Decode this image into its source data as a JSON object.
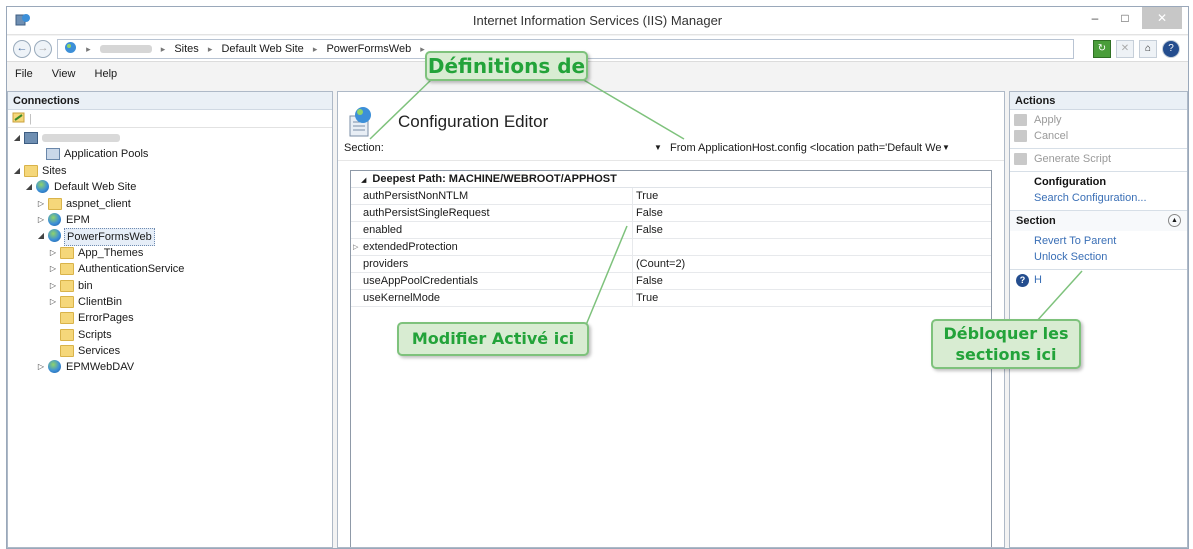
{
  "window": {
    "title": "Internet Information Services (IIS) Manager",
    "controls": {
      "minimize": "–",
      "maximize": "□",
      "close": "✕"
    }
  },
  "address": {
    "crumbs": [
      "Sites",
      "Default Web Site",
      "PowerFormsWeb"
    ],
    "separator": "▸"
  },
  "menu": [
    "File",
    "View",
    "Help"
  ],
  "connections": {
    "title": "Connections",
    "tree": [
      {
        "label": "",
        "blurred": true,
        "icon": "server-icon",
        "expander": "◢"
      },
      {
        "label": "Application Pools",
        "icon": "app-pool-icon",
        "expander": ""
      },
      {
        "label": "Sites",
        "icon": "sites-folder-icon",
        "expander": "◢"
      },
      {
        "label": "Default Web Site",
        "icon": "globe-icon",
        "expander": "◢"
      },
      {
        "label": "aspnet_client",
        "icon": "folder-icon",
        "expander": "▷"
      },
      {
        "label": "EPM",
        "icon": "web-app-icon",
        "expander": "▷"
      },
      {
        "label": "PowerFormsWeb",
        "icon": "web-app-icon",
        "expander": "◢",
        "selected": true
      },
      {
        "label": "App_Themes",
        "icon": "folder-icon",
        "expander": "▷"
      },
      {
        "label": "AuthenticationService",
        "icon": "folder-icon",
        "expander": "▷"
      },
      {
        "label": "bin",
        "icon": "folder-icon",
        "expander": "▷"
      },
      {
        "label": "ClientBin",
        "icon": "folder-icon",
        "expander": "▷"
      },
      {
        "label": "ErrorPages",
        "icon": "folder-icon",
        "expander": ""
      },
      {
        "label": "Scripts",
        "icon": "folder-icon",
        "expander": ""
      },
      {
        "label": "Services",
        "icon": "folder-icon",
        "expander": ""
      },
      {
        "label": "EPMWebDAV",
        "icon": "globe-icon",
        "expander": "▷"
      }
    ]
  },
  "editor": {
    "title": "Configuration Editor",
    "section_label": "Section:",
    "from_label": "From:",
    "from_value": "ApplicationHost.config <location path='Default We",
    "group_header": "Deepest Path: MACHINE/WEBROOT/APPHOST",
    "rows": [
      {
        "key": "authPersistNonNTLM",
        "value": "True",
        "expandable": false
      },
      {
        "key": "authPersistSingleRequest",
        "value": "False",
        "expandable": false
      },
      {
        "key": "enabled",
        "value": "False",
        "expandable": false
      },
      {
        "key": "extendedProtection",
        "value": "",
        "expandable": true
      },
      {
        "key": "providers",
        "value": "(Count=2)",
        "expandable": false
      },
      {
        "key": "useAppPoolCredentials",
        "value": "False",
        "expandable": false
      },
      {
        "key": "useKernelMode",
        "value": "True",
        "expandable": false
      }
    ]
  },
  "actions": {
    "title": "Actions",
    "apply": "Apply",
    "cancel": "Cancel",
    "generate_script": "Generate Script",
    "configuration": "Configuration",
    "search_configuration": "Search Configuration...",
    "section_title": "Section",
    "revert_to_parent": "Revert To Parent",
    "unlock_section": "Unlock Section",
    "help": "H"
  },
  "callouts": {
    "definitions": "Définitions de",
    "modify_enabled": "Modifier Activé ici",
    "unlock_sections": "Débloquer les sections ici"
  },
  "colors": {
    "callout_fill": "#d8ecd2",
    "callout_border": "#7ec27c",
    "callout_text": "#23a33a",
    "link": "#3a6fb6"
  }
}
